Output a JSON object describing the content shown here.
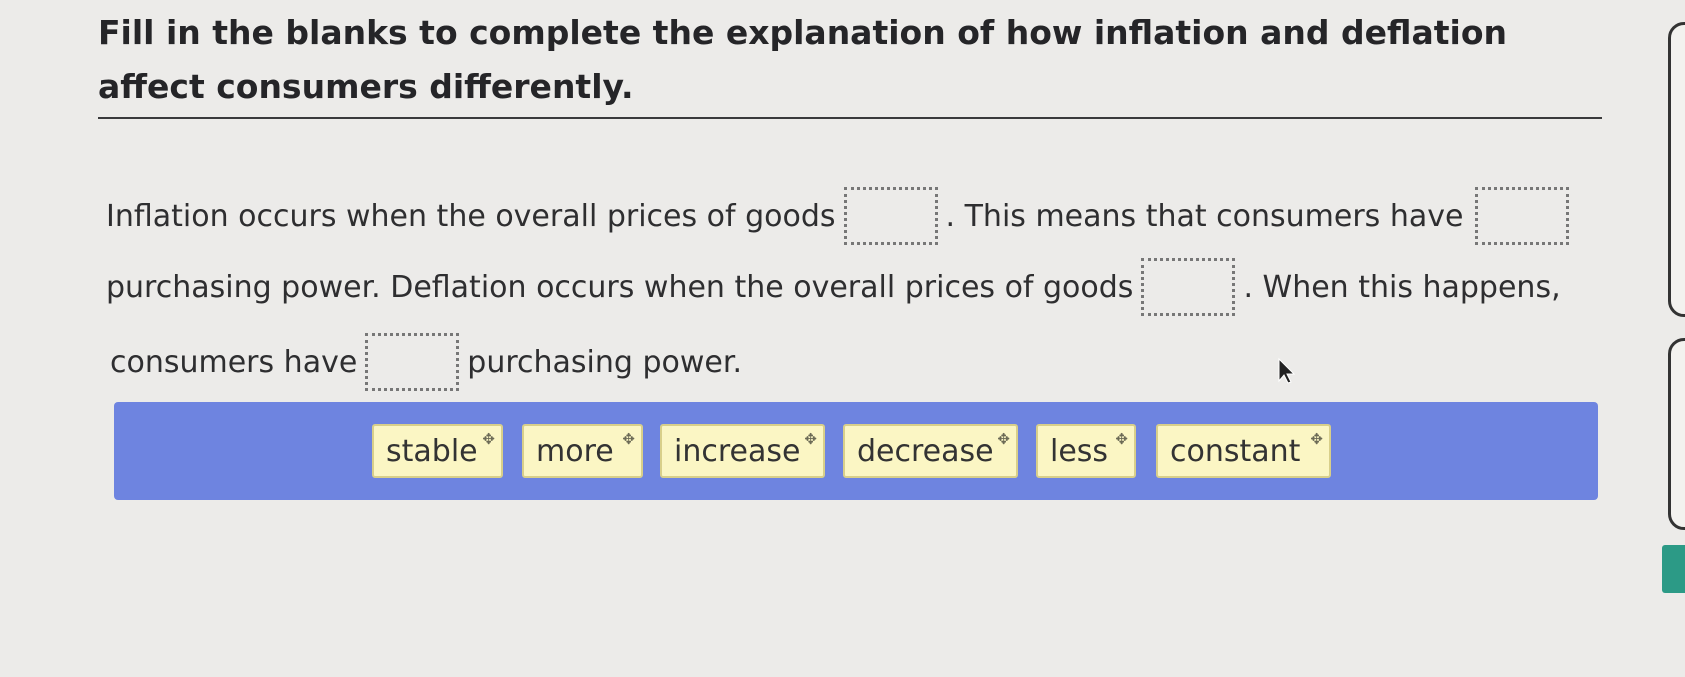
{
  "question": {
    "prompt": "Fill in the blanks to complete the explanation of how inflation and deflation affect consumers differently."
  },
  "passage": {
    "line1_before": "Inflation occurs when the overall prices of goods",
    "line1_after": ". This means that consumers have",
    "line2_before": "purchasing power. Deflation occurs when the overall prices of goods",
    "line2_after": ". When this happens,",
    "line3_before": "consumers have",
    "line3_after": "purchasing power."
  },
  "word_bank": {
    "drag_glyph": "✥",
    "options": [
      "stable",
      "more",
      "increase",
      "decrease",
      "less",
      "constant"
    ]
  },
  "colors": {
    "tray": "#6e84e0",
    "chip": "#fbf6c4",
    "side_accent": "#2c9a86"
  }
}
